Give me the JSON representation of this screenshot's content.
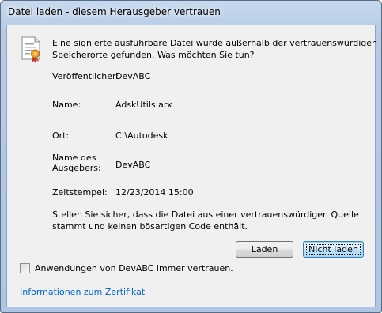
{
  "window": {
    "title": "Datei laden - diesem Herausgeber vertrauen"
  },
  "message": {
    "line1": "Eine signierte ausführbare Datei wurde außerhalb der vertrauenswürdigen",
    "line2": "Speicherorte gefunden. Was möchten Sie tun?"
  },
  "details": {
    "publisher_label": "Veröffentlicher:",
    "publisher_value": "DevABC",
    "name_label": "Name:",
    "name_value": "AdskUtils.arx",
    "location_label": "Ort:",
    "location_value": "C:\\Autodesk",
    "issuer_label_line1": "Name des",
    "issuer_label_line2": "Ausgebers:",
    "issuer_value": "DevABC",
    "timestamp_label": "Zeitstempel:",
    "timestamp_value": "12/23/2014 15:00"
  },
  "warning": {
    "line1": "Stellen Sie sicher, dass die Datei aus einer vertrauenswürdigen Quelle",
    "line2": "stammt und keinen bösartigen Code enthält."
  },
  "buttons": {
    "load_label": "Laden",
    "dont_load_label": "Nicht laden"
  },
  "checkbox": {
    "label": "Anwendungen von DevABC immer vertrauen.",
    "checked": false
  },
  "link": {
    "label": "Informationen zum Zertifikat"
  },
  "icons": {
    "certificate": "certificate-icon"
  }
}
